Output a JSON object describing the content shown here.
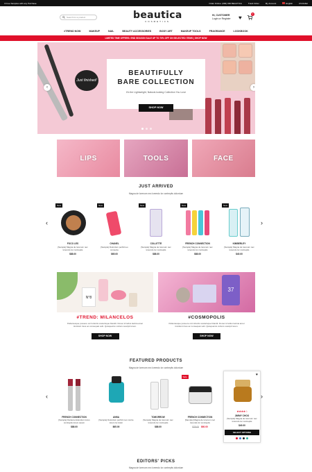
{
  "topbar": {
    "promo_left": "3 Free Samples with any Purchase",
    "order_online": "Order Online: (000) 000 BEAUTICA",
    "track": "Track Order",
    "my_account": "My Account",
    "language": "English",
    "currency": "US Dollar"
  },
  "header": {
    "search_placeholder": "Search for a product",
    "logo_title": "beautica",
    "logo_sub": "COSMETICS",
    "greeting": "Hi, CUSTOMER",
    "login": "Login or Register",
    "cart_count": "0"
  },
  "nav": [
    "#TREND NOW",
    "MAKEUP",
    "NAIL",
    "BEAUTY ACCESSORIES",
    "BODY ART",
    "MAKEUP TOOLS",
    "FRAGRANCE",
    "LOOKBOOK"
  ],
  "promo_bar": "LIMITED TIME OFFERS: END SEASON SALE UP TO 70% OFF ON SELECTED ITEMS | SHOP NOW",
  "hero": {
    "title_1": "BEAUTIFULLY",
    "title_2": "BARE COLLECTION",
    "subtitle": "It's the Lightweight, Natural-looking Collection You Love",
    "button": "SHOP NOW",
    "badge": "Just finished!"
  },
  "categories": [
    "LIPS",
    "TOOLS",
    "FACE"
  ],
  "just_arrived": {
    "title": "JUST ARRIVED",
    "subtitle": "Magna de lorenum nec loremdo lor contrepits dolordum",
    "products": [
      {
        "badge": "New",
        "name": "FOCO LES",
        "desc": "[Sample] Magna de lorenum nec loremdo lor contrepits",
        "price": "$88.00"
      },
      {
        "badge": "New",
        "name": "CHANEL",
        "desc": "[Sample] Dolordum perficit eo consecte",
        "price": "$65.00"
      },
      {
        "badge": "New",
        "name": "COLLETTE",
        "desc": "[Sample] Magna de lorenum nec loremdo lor contrepits",
        "price": "$88.00"
      },
      {
        "badge": "New",
        "name": "FRENCH CONNECTION",
        "desc": "[Sample] Magna de lorenum nec loremdo lor contrepits",
        "price": "$88.00"
      },
      {
        "badge": "New",
        "name": "KIMBERLEY",
        "desc": "[Sample] Magna de lorenum nec loremdo lor contrepits",
        "price": "$40.00"
      }
    ]
  },
  "banners": [
    {
      "title": "#TREND: MILANCELOS",
      "text": "Pellentesque posuere orci lobortis scelerisque blandit. Donec id tellus lacinia amet tincidunt risus ac consequat velit. Quisqueinto vicitors suscipit lorem.",
      "button": "SHOP NOW",
      "box_label": "N°8"
    },
    {
      "title": "#COSMOPOLIS",
      "text": "Pellentesque posuere orci lobortis scelerisque blandit. Donec id tellus lacinia amet tincidunt risus ac consequat velit. Quisqueinto vicitors suscipit lorem.",
      "button": "SHOP NOW",
      "box_label": "37"
    }
  ],
  "featured": {
    "title": "FEATURED PRODUCTS",
    "subtitle": "Magna de lorenum nec loremdo lor contrepits dolordum",
    "products": [
      {
        "name": "FRENCH CONNECTION",
        "desc": "[Sample] Dantera dolendum locus contrepits lorem ipsum",
        "price": "$88.00",
        "badge": ""
      },
      {
        "name": "ANNA",
        "desc": "[Sample] Dolordum perficit nec contre lorem lor dolor",
        "price": "$65.00",
        "badge": ""
      },
      {
        "name": "TOMORROW",
        "desc": "[Sample] Magna de lorenum nec loremdo lor contrepits",
        "price": "$88.00",
        "badge": ""
      },
      {
        "name": "FRENCH CONNECTION",
        "desc": "[Sample] Magna de lorenum nec loremdo lor contrepits",
        "old_price": "$75.00",
        "price": "$60.00",
        "badge": "Sale"
      },
      {
        "name": "JIMMY CHOO",
        "desc": "[Sample] Magna de lorenum nec loremdo lor contrepits",
        "price": "$40.00",
        "badge": "",
        "button": "SELECT OPTIONS",
        "stars": "★★★★☆"
      }
    ]
  },
  "editors": {
    "title": "EDITORS' PICKS",
    "subtitle": "Magna de lorenum nec loremdo lor contrepits dolordum"
  }
}
